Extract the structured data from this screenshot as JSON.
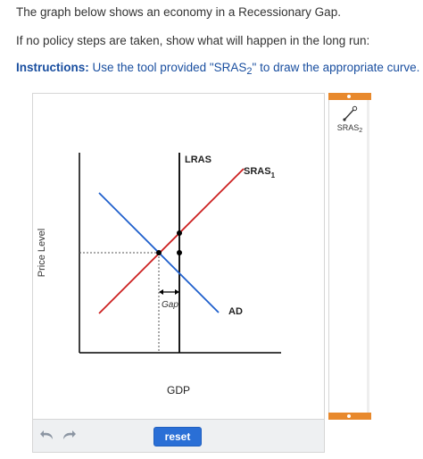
{
  "question": {
    "line1": "The graph below shows an economy in a Recessionary Gap.",
    "line2": "If no policy steps are taken, show what will happen in the long run:",
    "instructions_label": "Instructions:",
    "instructions_pre": " Use the tool provided \"SRAS",
    "instructions_sub": "2",
    "instructions_post": "\" to draw the appropriate curve."
  },
  "graph": {
    "ylabel": "Price Level",
    "xlabel": "GDP",
    "lras_label": "LRAS",
    "sras_label": "SRAS",
    "sras_sub": "1",
    "ad_label": "AD",
    "gap_label": "Gap",
    "colors": {
      "sras": "#cc1f1f",
      "ad": "#1f5fcc",
      "axis": "#000000",
      "guide": "#555555"
    }
  },
  "tools": {
    "tool_label": "SRAS",
    "tool_sub": "2",
    "tool_icon": "line-tool-icon",
    "accent": "#e8892d"
  },
  "controls": {
    "reset_label": "reset",
    "undo_icon": "undo-icon",
    "redo_icon": "redo-icon"
  }
}
